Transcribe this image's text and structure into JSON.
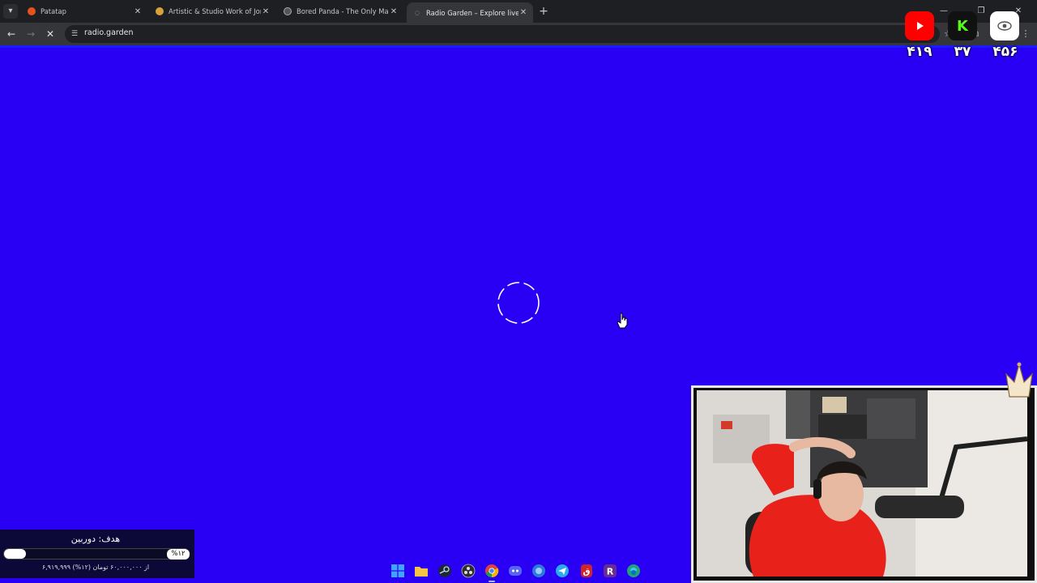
{
  "browser": {
    "tabs": [
      {
        "title": "Patatap",
        "favicon": "patatap-icon",
        "color": "#e5531a",
        "active": false
      },
      {
        "title": "Artistic & Studio Work of Jono",
        "favicon": "jono-icon",
        "color": "#d8a13c",
        "active": false
      },
      {
        "title": "Bored Panda - The Only Magazi",
        "favicon": "boredpanda-icon",
        "color": "#9a9a9a",
        "active": false
      },
      {
        "title": "Radio Garden – Explore live radi",
        "favicon": "radio-garden-icon",
        "color": "#9a9a9a",
        "active": true
      }
    ],
    "url": "radio.garden"
  },
  "overlay": {
    "counters": [
      {
        "platform": "youtube",
        "icon": "youtube-icon",
        "value": "۴۱۹",
        "color": "#ff0000"
      },
      {
        "platform": "kick",
        "icon": "kick-icon",
        "label": "K",
        "value": "۳۷",
        "color": "#53fc18"
      },
      {
        "platform": "viewers",
        "icon": "eye-icon",
        "value": "۴۵۶",
        "color": "#ffffff"
      }
    ],
    "goal": {
      "title": "هدف: دوربین",
      "percent_label": "%۱۲",
      "progress": 0.12,
      "subtitle": "۶,۹۱۹,۹۹۹ از ۶۰,۰۰۰,۰۰۰ تومان (۱۲%)"
    }
  },
  "page": {
    "background": "#2a00f5",
    "state": "loading"
  },
  "taskbar": {
    "icons": [
      {
        "name": "windows-start-icon",
        "color": "#3ea6ff"
      },
      {
        "name": "file-explorer-icon",
        "color": "#f6c343"
      },
      {
        "name": "steam-icon",
        "color": "#1b2838"
      },
      {
        "name": "obs-icon",
        "color": "#3a3a3a"
      },
      {
        "name": "chrome-icon",
        "color": "#db4437",
        "active": true
      },
      {
        "name": "discord-icon",
        "color": "#5865f2"
      },
      {
        "name": "app-icon",
        "color": "#2b7bd8"
      },
      {
        "name": "telegram-icon",
        "color": "#2aabee"
      },
      {
        "name": "app-red-icon",
        "color": "#d0242b"
      },
      {
        "name": "rockstar-icon",
        "color": "#6a2c91",
        "label": "R"
      },
      {
        "name": "edge-icon",
        "color": "#1fa37a"
      }
    ]
  }
}
